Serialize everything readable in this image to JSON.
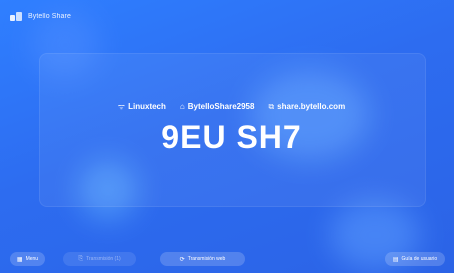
{
  "app": {
    "title": "Bytello Share",
    "logo_icon": "bytello-logo-icon"
  },
  "connection": {
    "wifi_icon": "wifi-icon",
    "wifi": "Linuxtech",
    "device_icon": "device-icon",
    "device": "BytelloShare2958",
    "link_icon": "link-icon",
    "url": "share.bytello.com"
  },
  "share_code": "9EU SH7",
  "bottom": {
    "menu": {
      "label": "Menu",
      "icon": "menu-grid-icon"
    },
    "cast": {
      "label": "Transmisión (1)",
      "icon": "cast-icon",
      "state": "disabled"
    },
    "web": {
      "label": "Transmisión web",
      "icon": "web-icon"
    },
    "guide": {
      "label": "Guía de usuario",
      "icon": "guide-icon"
    }
  },
  "colors": {
    "background": "#2d6cf0",
    "accent": "#ffffff"
  }
}
